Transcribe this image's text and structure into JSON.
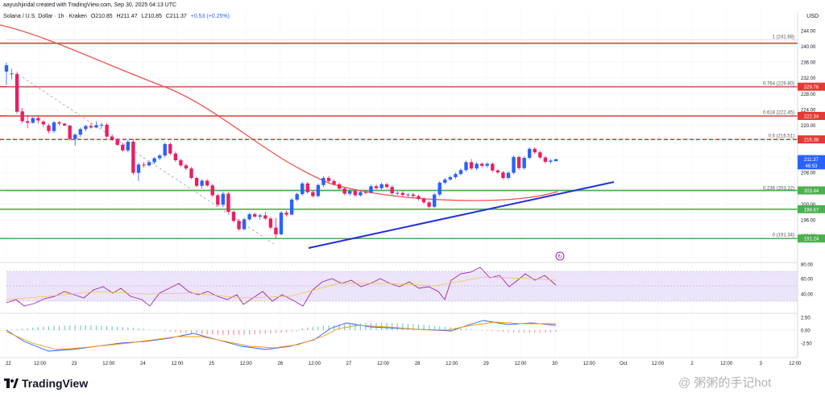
{
  "header": {
    "created_by": "aayushjindal created with TradingView.com, Sep 30, 2025 04:13 UTC",
    "symbol": "Solana / U.S. Dollar · 1h · Kraken",
    "open": "O210.85",
    "high": "H211.47",
    "low": "L210.85",
    "close": "C211.37",
    "change": "+0.53 (+0.25%)",
    "currency": "USD"
  },
  "colors": {
    "up": "#2962ff",
    "down": "#e91e63",
    "ma": "#ef5350",
    "trendline": "#2130d8",
    "resistance": "#e53935",
    "support": "#4caf50",
    "rsi": "#9c27b0",
    "rsi_band": "#e8dcf7"
  },
  "price_axis": {
    "ticks": [
      "244.00",
      "240.00",
      "236.00",
      "232.00",
      "228.00",
      "224.00",
      "220.00",
      "216.00",
      "212.00",
      "208.00",
      "204.00",
      "200.00",
      "196.00",
      "192.00"
    ],
    "badges": [
      {
        "label": "229.76",
        "price": 229.76,
        "color": "#e53935"
      },
      {
        "label": "222.34",
        "price": 222.34,
        "color": "#e53935"
      },
      {
        "label": "216.38",
        "price": 216.38,
        "color": "#e53935"
      },
      {
        "label": "211.37",
        "price": 211.37,
        "color": "#2962ff"
      },
      {
        "label": "46:53",
        "price": 209.8,
        "color": "#2962ff"
      },
      {
        "label": "203.44",
        "price": 203.44,
        "color": "#4caf50"
      },
      {
        "label": "198.67",
        "price": 198.67,
        "color": "#4caf50"
      },
      {
        "label": "191.24",
        "price": 191.24,
        "color": "#4caf50"
      }
    ]
  },
  "time_axis": [
    "22",
    "12:00",
    "23",
    "12:00",
    "24",
    "12:00",
    "25",
    "12:00",
    "26",
    "12:00",
    "27",
    "12:00",
    "28",
    "12:00",
    "29",
    "12:00",
    "30",
    "12:00",
    "Oct",
    "12:00",
    "2",
    "12:00",
    "3",
    "12:00"
  ],
  "fib_levels": [
    {
      "label": "1 (241.68)",
      "price": 241.68
    },
    {
      "label": "0.764 (229.80)",
      "price": 229.8
    },
    {
      "label": "0.618 (222.45)",
      "price": 222.45
    },
    {
      "label": "0.5 (216.51)",
      "price": 216.51
    },
    {
      "label": "0.236 (203.22)",
      "price": 203.22
    },
    {
      "label": "0 (191.34)",
      "price": 191.34
    }
  ],
  "horizontal_lines": [
    {
      "price": 240.8,
      "color": "#e53935"
    },
    {
      "price": 229.76,
      "color": "#e53935"
    },
    {
      "price": 222.34,
      "color": "#e53935"
    },
    {
      "price": 216.38,
      "color": "#e53935",
      "dashed": true
    },
    {
      "price": 203.44,
      "color": "#4caf50"
    },
    {
      "price": 198.67,
      "color": "#4caf50"
    },
    {
      "price": 191.24,
      "color": "#4caf50"
    }
  ],
  "rsi_axis": [
    "80.00",
    "60.00",
    "40.00"
  ],
  "macd_axis": [
    "2.50",
    "0.00",
    "-2.50"
  ],
  "footer": {
    "logo": "TradingView",
    "watermark": "@ 粥粥的手记hot"
  },
  "chart_data": {
    "type": "candlestick",
    "title": "Solana / U.S. Dollar · 1h · Kraken",
    "ylim": [
      188,
      244
    ],
    "candles": [
      {
        "o": 233.6,
        "h": 235.9,
        "l": 230.2,
        "c": 235.2
      },
      {
        "o": 232.9,
        "h": 234.3,
        "l": 231.6,
        "c": 233.1
      },
      {
        "o": 233.0,
        "h": 233.6,
        "l": 222.9,
        "c": 223.4
      },
      {
        "o": 223.5,
        "h": 224.4,
        "l": 220.5,
        "c": 221.0
      },
      {
        "o": 221.0,
        "h": 222.6,
        "l": 219.2,
        "c": 220.6
      },
      {
        "o": 220.6,
        "h": 222.1,
        "l": 220.4,
        "c": 221.8
      },
      {
        "o": 221.8,
        "h": 222.3,
        "l": 220.4,
        "c": 221.2
      },
      {
        "o": 220.9,
        "h": 221.4,
        "l": 219.5,
        "c": 220.2
      },
      {
        "o": 219.9,
        "h": 220.4,
        "l": 217.9,
        "c": 218.5
      },
      {
        "o": 218.5,
        "h": 221.1,
        "l": 218.0,
        "c": 220.7
      },
      {
        "o": 220.7,
        "h": 221.1,
        "l": 219.8,
        "c": 220.4
      },
      {
        "o": 220.4,
        "h": 220.5,
        "l": 219.8,
        "c": 219.9
      },
      {
        "o": 219.9,
        "h": 220.0,
        "l": 216.1,
        "c": 216.5
      },
      {
        "o": 216.5,
        "h": 217.9,
        "l": 214.8,
        "c": 217.6
      },
      {
        "o": 217.6,
        "h": 219.4,
        "l": 217.0,
        "c": 219.0
      },
      {
        "o": 219.0,
        "h": 220.1,
        "l": 218.4,
        "c": 219.8
      },
      {
        "o": 219.8,
        "h": 220.5,
        "l": 219.1,
        "c": 219.4
      },
      {
        "o": 219.4,
        "h": 221.0,
        "l": 219.2,
        "c": 220.0
      },
      {
        "o": 220.0,
        "h": 220.6,
        "l": 219.2,
        "c": 220.1
      },
      {
        "o": 220.1,
        "h": 220.6,
        "l": 216.8,
        "c": 217.1
      },
      {
        "o": 217.1,
        "h": 217.7,
        "l": 216.0,
        "c": 216.4
      },
      {
        "o": 216.4,
        "h": 216.8,
        "l": 214.7,
        "c": 215.0
      },
      {
        "o": 215.0,
        "h": 215.6,
        "l": 213.2,
        "c": 213.6
      },
      {
        "o": 213.6,
        "h": 216.2,
        "l": 213.1,
        "c": 215.8
      },
      {
        "o": 215.8,
        "h": 216.5,
        "l": 207.4,
        "c": 207.9
      },
      {
        "o": 207.9,
        "h": 210.4,
        "l": 205.8,
        "c": 210.0
      },
      {
        "o": 210.0,
        "h": 210.6,
        "l": 209.2,
        "c": 209.8
      },
      {
        "o": 209.8,
        "h": 211.0,
        "l": 209.5,
        "c": 210.6
      },
      {
        "o": 210.6,
        "h": 211.9,
        "l": 210.1,
        "c": 211.6
      },
      {
        "o": 211.6,
        "h": 212.7,
        "l": 211.1,
        "c": 212.3
      },
      {
        "o": 212.3,
        "h": 215.6,
        "l": 211.8,
        "c": 215.2
      },
      {
        "o": 215.2,
        "h": 215.6,
        "l": 212.4,
        "c": 212.8
      },
      {
        "o": 212.8,
        "h": 213.3,
        "l": 210.7,
        "c": 211.1
      },
      {
        "o": 211.1,
        "h": 211.5,
        "l": 209.4,
        "c": 209.8
      },
      {
        "o": 209.8,
        "h": 210.3,
        "l": 208.6,
        "c": 209.0
      },
      {
        "o": 209.0,
        "h": 209.4,
        "l": 206.3,
        "c": 206.6
      },
      {
        "o": 206.6,
        "h": 207.0,
        "l": 204.2,
        "c": 204.6
      },
      {
        "o": 204.6,
        "h": 206.3,
        "l": 203.9,
        "c": 205.9
      },
      {
        "o": 205.9,
        "h": 206.3,
        "l": 204.3,
        "c": 204.7
      },
      {
        "o": 204.7,
        "h": 205.1,
        "l": 201.8,
        "c": 202.2
      },
      {
        "o": 202.2,
        "h": 202.6,
        "l": 199.4,
        "c": 199.8
      },
      {
        "o": 199.8,
        "h": 203.1,
        "l": 199.2,
        "c": 202.6
      },
      {
        "o": 202.6,
        "h": 203.0,
        "l": 197.6,
        "c": 198.0
      },
      {
        "o": 198.0,
        "h": 198.4,
        "l": 195.3,
        "c": 195.7
      },
      {
        "o": 195.7,
        "h": 196.2,
        "l": 193.2,
        "c": 193.6
      },
      {
        "o": 193.6,
        "h": 196.5,
        "l": 193.3,
        "c": 196.1
      },
      {
        "o": 196.1,
        "h": 197.8,
        "l": 195.7,
        "c": 197.4
      },
      {
        "o": 197.4,
        "h": 197.8,
        "l": 196.4,
        "c": 196.8
      },
      {
        "o": 196.8,
        "h": 197.5,
        "l": 196.1,
        "c": 197.1
      },
      {
        "o": 197.1,
        "h": 198.0,
        "l": 196.0,
        "c": 196.3
      },
      {
        "o": 196.3,
        "h": 196.7,
        "l": 193.6,
        "c": 194.0
      },
      {
        "o": 194.0,
        "h": 196.5,
        "l": 191.3,
        "c": 192.3
      },
      {
        "o": 192.3,
        "h": 198.2,
        "l": 192.0,
        "c": 197.8
      },
      {
        "o": 197.8,
        "h": 198.3,
        "l": 196.8,
        "c": 197.3
      },
      {
        "o": 197.3,
        "h": 201.5,
        "l": 197.1,
        "c": 201.1
      },
      {
        "o": 201.1,
        "h": 202.9,
        "l": 200.7,
        "c": 202.5
      },
      {
        "o": 202.5,
        "h": 205.6,
        "l": 202.1,
        "c": 205.2
      },
      {
        "o": 205.2,
        "h": 205.6,
        "l": 202.6,
        "c": 203.0
      },
      {
        "o": 203.0,
        "h": 203.4,
        "l": 201.6,
        "c": 202.0
      },
      {
        "o": 202.0,
        "h": 205.2,
        "l": 201.7,
        "c": 204.8
      },
      {
        "o": 204.8,
        "h": 207.0,
        "l": 204.3,
        "c": 206.6
      },
      {
        "o": 206.6,
        "h": 207.1,
        "l": 205.3,
        "c": 205.8
      },
      {
        "o": 205.8,
        "h": 206.2,
        "l": 204.6,
        "c": 205.0
      },
      {
        "o": 205.0,
        "h": 205.4,
        "l": 203.5,
        "c": 203.9
      },
      {
        "o": 203.9,
        "h": 204.3,
        "l": 202.2,
        "c": 202.6
      },
      {
        "o": 202.6,
        "h": 203.7,
        "l": 202.1,
        "c": 203.3
      },
      {
        "o": 203.3,
        "h": 203.7,
        "l": 201.8,
        "c": 202.2
      },
      {
        "o": 202.2,
        "h": 203.4,
        "l": 201.9,
        "c": 203.0
      },
      {
        "o": 203.0,
        "h": 203.5,
        "l": 202.5,
        "c": 202.9
      },
      {
        "o": 202.9,
        "h": 204.9,
        "l": 202.6,
        "c": 204.5
      },
      {
        "o": 204.5,
        "h": 204.9,
        "l": 203.6,
        "c": 204.0
      },
      {
        "o": 204.0,
        "h": 205.4,
        "l": 203.6,
        "c": 205.0
      },
      {
        "o": 205.0,
        "h": 205.4,
        "l": 203.9,
        "c": 204.3
      },
      {
        "o": 204.3,
        "h": 204.7,
        "l": 202.3,
        "c": 202.7
      },
      {
        "o": 202.7,
        "h": 203.2,
        "l": 202.2,
        "c": 202.8
      },
      {
        "o": 202.8,
        "h": 203.2,
        "l": 201.9,
        "c": 202.3
      },
      {
        "o": 202.3,
        "h": 202.8,
        "l": 201.8,
        "c": 202.4
      },
      {
        "o": 202.4,
        "h": 202.8,
        "l": 201.6,
        "c": 202.0
      },
      {
        "o": 202.0,
        "h": 202.4,
        "l": 200.9,
        "c": 201.3
      },
      {
        "o": 201.3,
        "h": 201.7,
        "l": 200.0,
        "c": 200.4
      },
      {
        "o": 200.4,
        "h": 200.8,
        "l": 198.9,
        "c": 199.3
      },
      {
        "o": 199.3,
        "h": 202.8,
        "l": 199.0,
        "c": 202.4
      },
      {
        "o": 202.4,
        "h": 205.8,
        "l": 202.0,
        "c": 205.4
      },
      {
        "o": 205.4,
        "h": 206.6,
        "l": 205.0,
        "c": 206.2
      },
      {
        "o": 206.2,
        "h": 207.2,
        "l": 205.9,
        "c": 206.8
      },
      {
        "o": 206.8,
        "h": 208.0,
        "l": 206.4,
        "c": 207.6
      },
      {
        "o": 207.6,
        "h": 209.0,
        "l": 207.3,
        "c": 208.6
      },
      {
        "o": 208.6,
        "h": 211.0,
        "l": 208.2,
        "c": 210.6
      },
      {
        "o": 210.6,
        "h": 211.4,
        "l": 208.6,
        "c": 209.0
      },
      {
        "o": 209.0,
        "h": 210.6,
        "l": 208.6,
        "c": 210.2
      },
      {
        "o": 210.2,
        "h": 210.6,
        "l": 209.3,
        "c": 209.7
      },
      {
        "o": 209.7,
        "h": 210.6,
        "l": 209.2,
        "c": 210.2
      },
      {
        "o": 210.2,
        "h": 210.5,
        "l": 208.1,
        "c": 208.5
      },
      {
        "o": 208.5,
        "h": 208.9,
        "l": 207.6,
        "c": 208.0
      },
      {
        "o": 208.0,
        "h": 208.4,
        "l": 206.2,
        "c": 206.6
      },
      {
        "o": 206.6,
        "h": 208.3,
        "l": 206.2,
        "c": 207.9
      },
      {
        "o": 207.9,
        "h": 212.3,
        "l": 207.5,
        "c": 211.9
      },
      {
        "o": 211.9,
        "h": 212.3,
        "l": 208.7,
        "c": 209.1
      },
      {
        "o": 209.1,
        "h": 212.1,
        "l": 208.7,
        "c": 211.7
      },
      {
        "o": 211.7,
        "h": 214.4,
        "l": 211.3,
        "c": 214.0
      },
      {
        "o": 214.0,
        "h": 214.4,
        "l": 212.7,
        "c": 213.1
      },
      {
        "o": 213.1,
        "h": 213.5,
        "l": 211.4,
        "c": 211.8
      },
      {
        "o": 211.8,
        "h": 212.2,
        "l": 210.3,
        "c": 210.7
      },
      {
        "o": 210.7,
        "h": 211.4,
        "l": 210.3,
        "c": 211.0
      },
      {
        "o": 210.85,
        "h": 211.47,
        "l": 210.85,
        "c": 211.37
      }
    ]
  }
}
